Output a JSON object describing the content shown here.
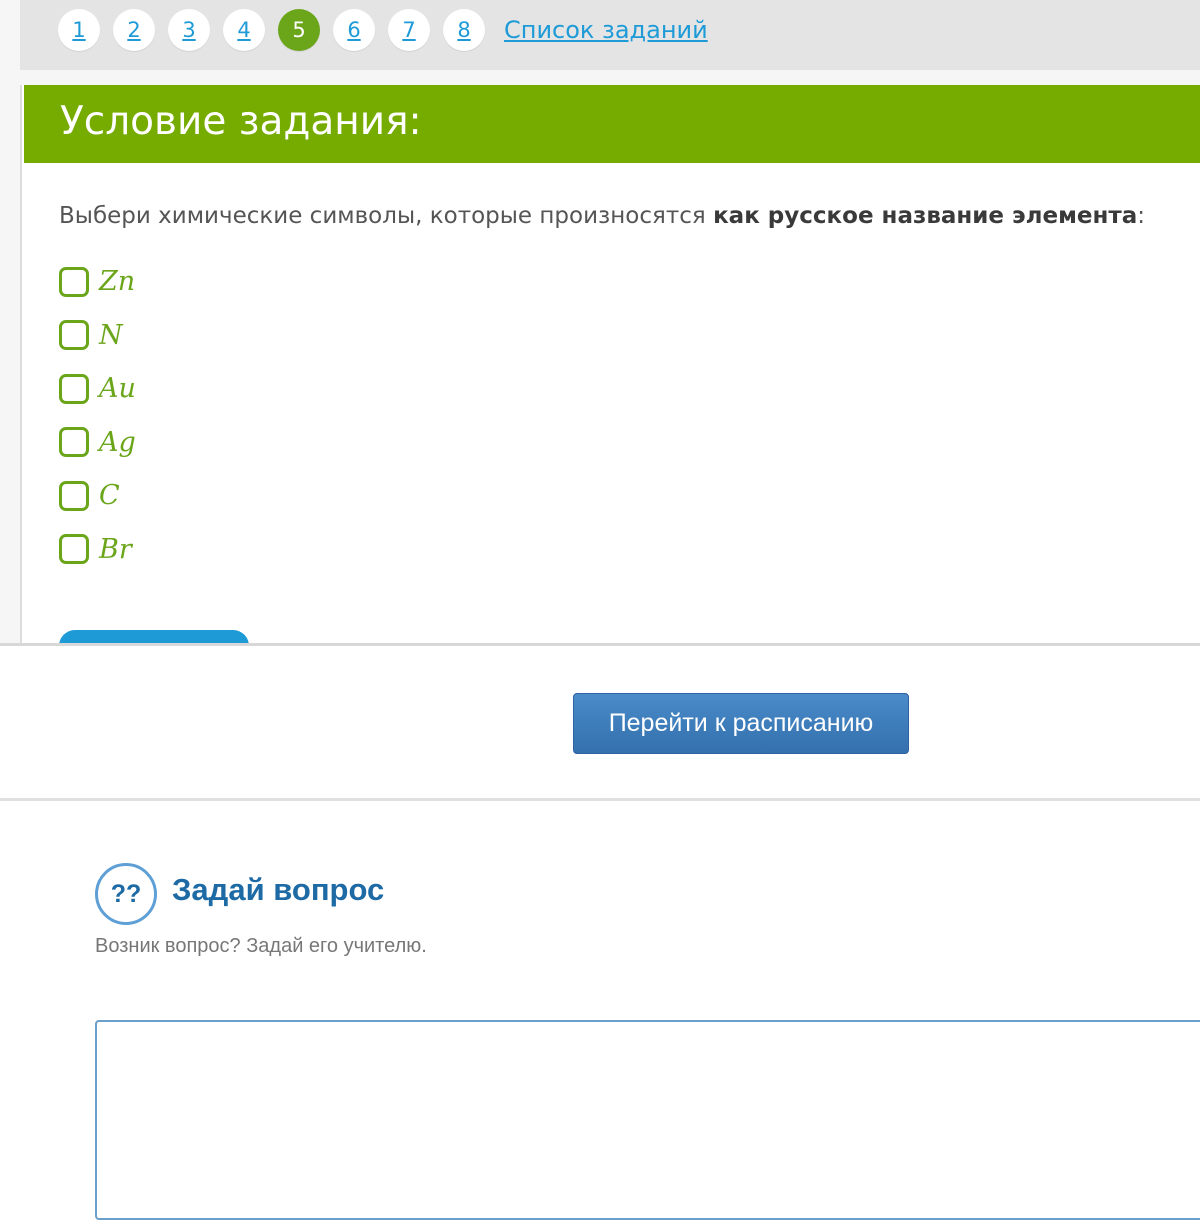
{
  "pager": {
    "pages": [
      "1",
      "2",
      "3",
      "4",
      "5",
      "6",
      "7",
      "8"
    ],
    "active_page": "5",
    "task_list_label": "Список заданий"
  },
  "task": {
    "header": "Условие задания:",
    "prompt_plain": "Выбери химические символы, которые произносятся ",
    "prompt_bold": "как русское название элемента",
    "prompt_end": ":",
    "options": [
      "Zn",
      "N",
      "Au",
      "Ag",
      "C",
      "Br"
    ]
  },
  "schedule": {
    "button_label": "Перейти к расписанию"
  },
  "ask": {
    "icon": "question-icon",
    "icon_glyph": "??",
    "title": "Задай вопрос",
    "subtitle": "Возник вопрос? Задай его учителю.",
    "textarea_value": ""
  },
  "colors": {
    "accent_green": "#76ab00",
    "link_blue": "#1e9bd7",
    "button_blue": "#3370ad",
    "title_blue": "#1d6aa5"
  }
}
